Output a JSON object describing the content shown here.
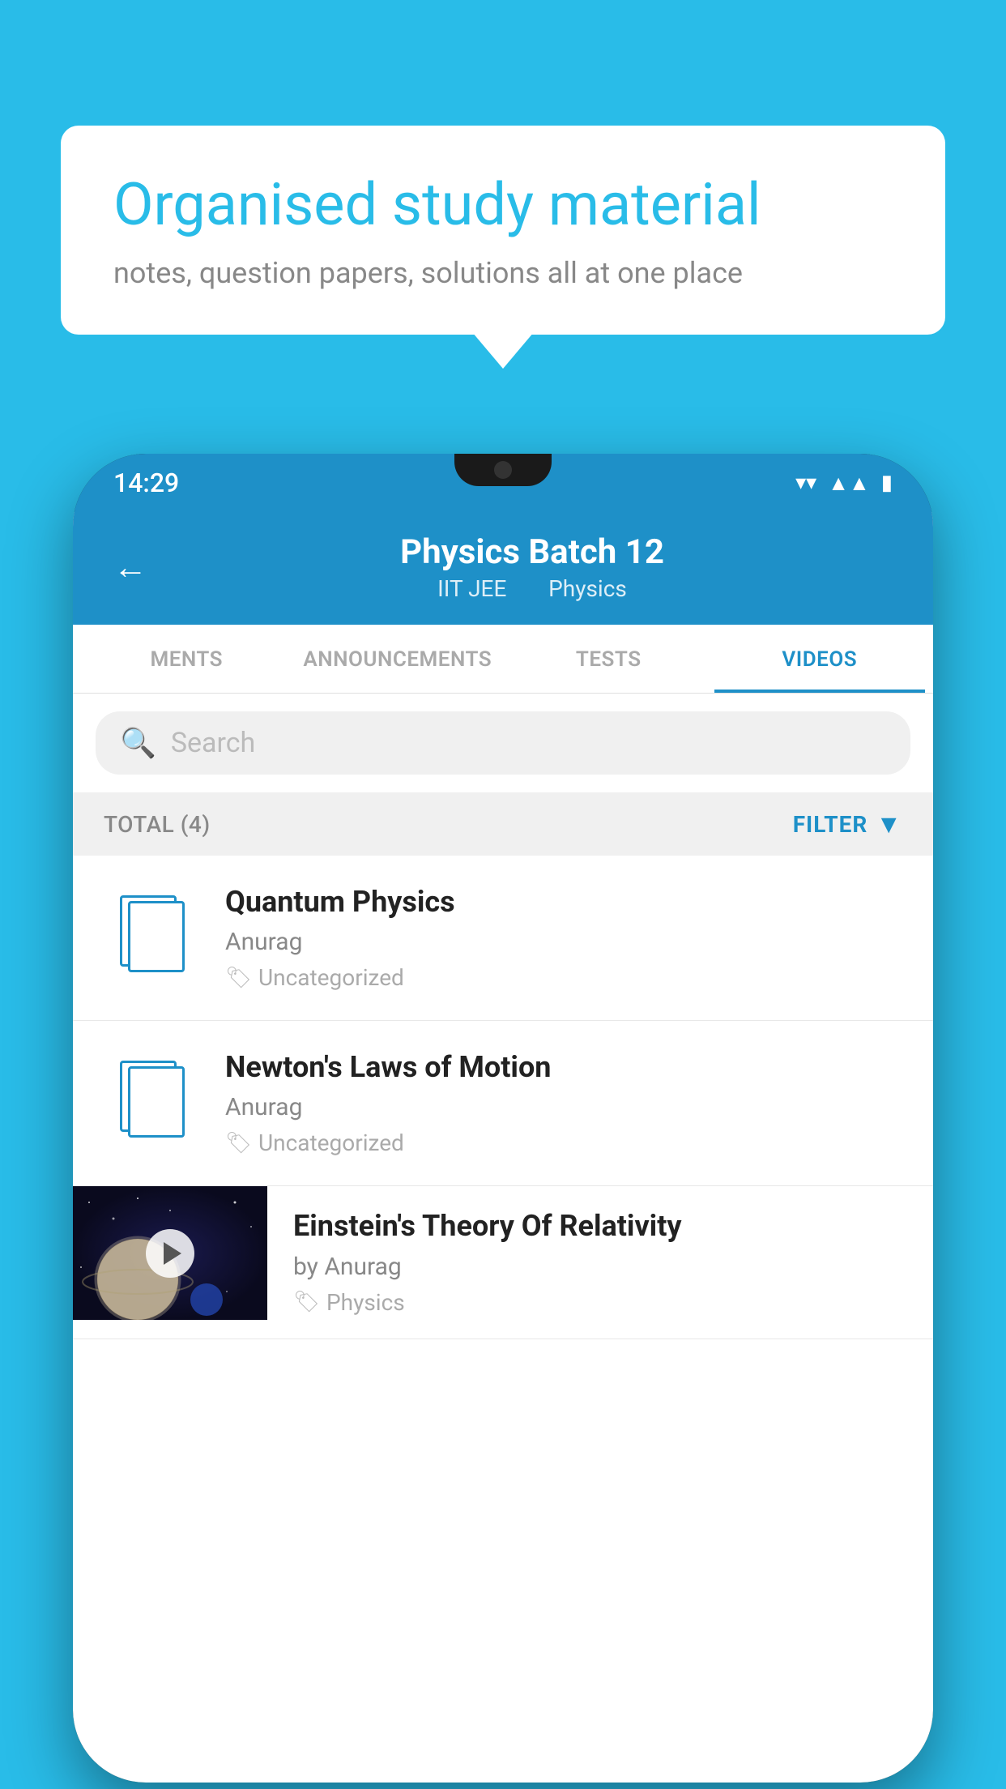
{
  "background": {
    "color": "#29bce8"
  },
  "bubble": {
    "title": "Organised study material",
    "subtitle": "notes, question papers, solutions all at one place"
  },
  "phone": {
    "status_bar": {
      "time": "14:29"
    },
    "header": {
      "title": "Physics Batch 12",
      "subtitle_part1": "IIT JEE",
      "subtitle_part2": "Physics",
      "back_label": "←"
    },
    "tabs": [
      {
        "label": "MENTS",
        "active": false
      },
      {
        "label": "ANNOUNCEMENTS",
        "active": false
      },
      {
        "label": "TESTS",
        "active": false
      },
      {
        "label": "VIDEOS",
        "active": true
      }
    ],
    "search": {
      "placeholder": "Search"
    },
    "list_meta": {
      "total_label": "TOTAL (4)",
      "filter_label": "FILTER"
    },
    "videos": [
      {
        "title": "Quantum Physics",
        "author": "Anurag",
        "tag": "Uncategorized",
        "has_thumbnail": false
      },
      {
        "title": "Newton's Laws of Motion",
        "author": "Anurag",
        "tag": "Uncategorized",
        "has_thumbnail": false
      },
      {
        "title": "Einstein's Theory Of Relativity",
        "author": "by Anurag",
        "tag": "Physics",
        "has_thumbnail": true
      }
    ]
  }
}
